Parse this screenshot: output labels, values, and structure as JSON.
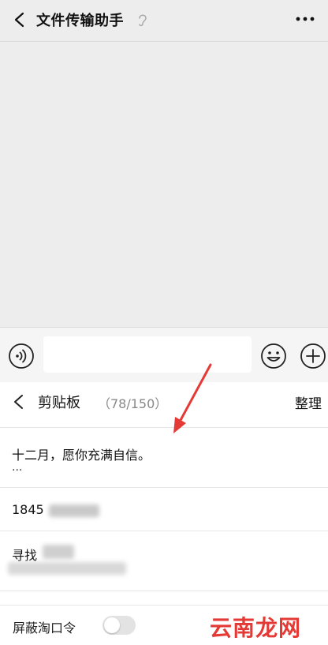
{
  "header": {
    "title": "文件传输助手",
    "more_icon": "more-dots-icon"
  },
  "clipboard": {
    "title": "剪贴板",
    "count": "（78/150）",
    "action": "整理",
    "items": [
      {
        "line1": "十二月，愿你充满自信。",
        "line2": "..."
      },
      {
        "line1": "1845"
      },
      {
        "line1": "寻找"
      }
    ]
  },
  "settings": {
    "toggle_label": "屏蔽淘口令",
    "toggle_on": false
  },
  "watermark": "云南龙网",
  "colors": {
    "arrow": "#e53935",
    "watermark": "#e53935"
  }
}
